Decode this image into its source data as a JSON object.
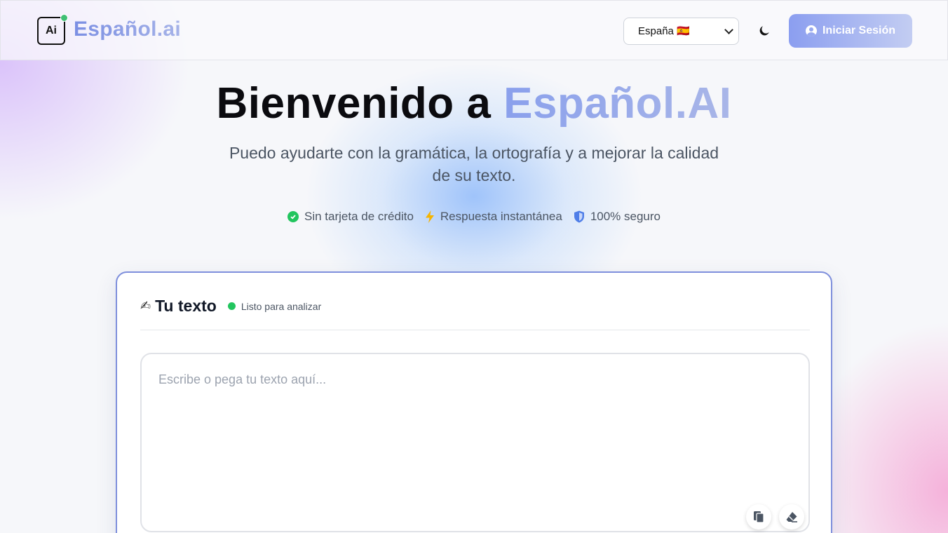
{
  "header": {
    "logo_text": "Ai",
    "brand": "Español.ai",
    "language_selected": "España 🇪🇸",
    "language_options": [
      "España 🇪🇸"
    ],
    "theme_icon": "moon-icon",
    "login_label": "Iniciar Sesión",
    "login_icon": "user-circle-icon"
  },
  "hero": {
    "title_prefix": "Bienvenido a",
    "title_accent": "Español.AI",
    "subtitle": "Puedo ayudarte con la gramática, la ortografía y a mejorar la calidad de su texto.",
    "features": [
      {
        "icon": "check-circle-icon",
        "label": "Sin tarjeta de crédito"
      },
      {
        "icon": "lightning-icon",
        "label": "Respuesta instantánea"
      },
      {
        "icon": "shield-icon",
        "label": "100% seguro"
      }
    ]
  },
  "editor": {
    "title_icon": "writing-hand-icon",
    "title": "Tu texto",
    "status": "Listo para analizar",
    "placeholder": "Escribe o pega tu texto aquí...",
    "value": "",
    "tools": [
      "paste-icon",
      "eraser-icon"
    ]
  },
  "colors": {
    "accent": "#7e8fdc",
    "status_green": "#22c55e",
    "login_gradient_start": "#8b9ef0"
  }
}
